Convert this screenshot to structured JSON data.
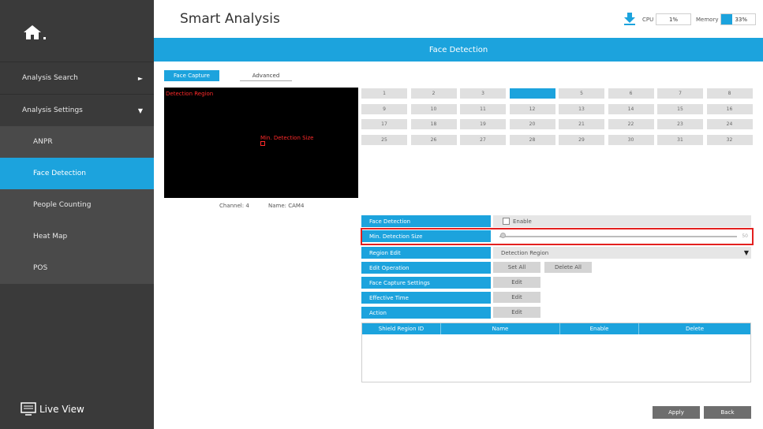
{
  "header": {
    "title": "Smart Analysis",
    "cpu_label": "CPU",
    "cpu_value": "1%",
    "memory_label": "Memory",
    "memory_value": "33%",
    "memory_fraction": 0.33
  },
  "sidebar": {
    "items": [
      {
        "label": "Analysis Search",
        "arrow": "►"
      },
      {
        "label": "Analysis Settings",
        "arrow": "▼"
      },
      {
        "label": "ANPR"
      },
      {
        "label": "Face Detection"
      },
      {
        "label": "People Counting"
      },
      {
        "label": "Heat Map"
      },
      {
        "label": "POS"
      }
    ],
    "live_view": "Live View"
  },
  "section_title": "Face Detection",
  "tabs": {
    "face_capture": "Face Capture",
    "advanced": "Advanced"
  },
  "preview": {
    "detection_region_label": "Detection Region",
    "min_size_label": "Min. Detection Size"
  },
  "channel_info": {
    "channel": "Channel: 4",
    "name": "Name: CAM4"
  },
  "channels": [
    "1",
    "2",
    "3",
    "4",
    "5",
    "6",
    "7",
    "8",
    "9",
    "10",
    "11",
    "12",
    "13",
    "14",
    "15",
    "16",
    "17",
    "18",
    "19",
    "20",
    "21",
    "22",
    "23",
    "24",
    "25",
    "26",
    "27",
    "28",
    "29",
    "30",
    "31",
    "32"
  ],
  "selected_channel": "4",
  "settings": {
    "face_detection_label": "Face Detection",
    "enable_label": "Enable",
    "min_size_label": "Min. Detection Size",
    "min_size_value": "50",
    "region_edit_label": "Region Edit",
    "region_edit_value": "Detection Region",
    "edit_operation_label": "Edit Operation",
    "set_all": "Set All",
    "delete_all": "Delete All",
    "face_capture_settings_label": "Face Capture Settings",
    "effective_time_label": "Effective Time",
    "action_label": "Action",
    "edit": "Edit"
  },
  "shield_table": {
    "columns": [
      "Shield Region ID",
      "Name",
      "Enable",
      "Delete"
    ]
  },
  "buttons": {
    "apply": "Apply",
    "back": "Back"
  },
  "colors": {
    "accent": "#1ca3dd",
    "sidebar": "#3a3a3a",
    "highlight": "#e3201f"
  }
}
